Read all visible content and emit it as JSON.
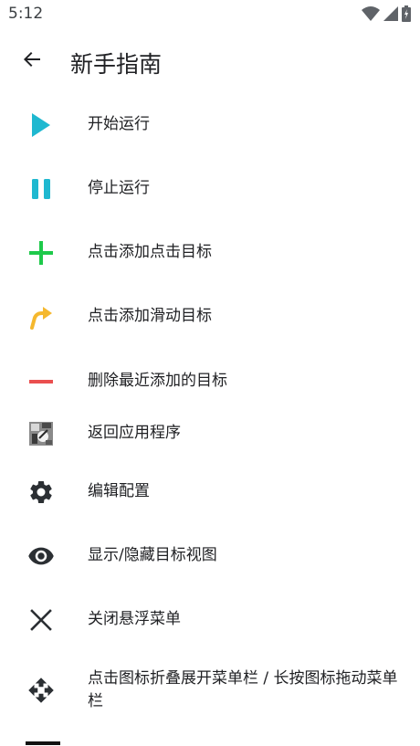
{
  "status_bar": {
    "time": "5:12"
  },
  "header": {
    "title": "新手指南"
  },
  "items": [
    {
      "label": "开始运行",
      "icon": "play-icon",
      "color": "#1fb8d0"
    },
    {
      "label": "停止运行",
      "icon": "pause-icon",
      "color": "#1fb8d0"
    },
    {
      "label": "点击添加点击目标",
      "icon": "plus-icon",
      "color": "#1ec94a"
    },
    {
      "label": "点击添加滑动目标",
      "icon": "swipe-arrow-icon",
      "color": "#f5b82e"
    },
    {
      "label": "删除最近添加的目标",
      "icon": "minus-icon",
      "color": "#ea4f4f"
    },
    {
      "label": "返回应用程序",
      "icon": "app-thumbnail-icon"
    },
    {
      "label": "编辑配置",
      "icon": "gear-icon",
      "color": "#2b2f33"
    },
    {
      "label": "显示/隐藏目标视图",
      "icon": "eye-icon",
      "color": "#2b2f33"
    },
    {
      "label": "关闭悬浮菜单",
      "icon": "close-icon",
      "color": "#2b2f33"
    },
    {
      "label": "点击图标折叠展开菜单栏 / 长按图标拖动菜单栏",
      "icon": "move-icon",
      "color": "#2b2f33"
    }
  ]
}
